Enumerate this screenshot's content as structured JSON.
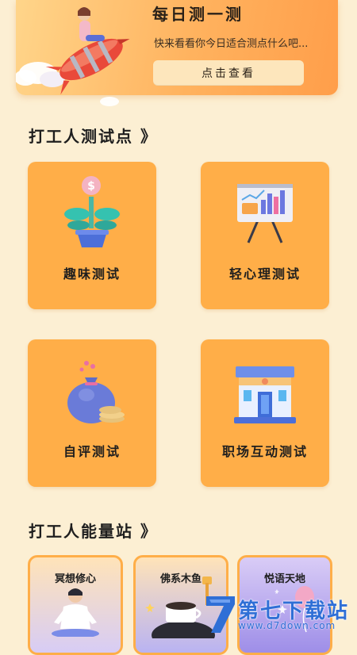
{
  "banner": {
    "title": "每日测一测",
    "subtitle": "快来看看你今日适合测点什么吧...",
    "button_label": "点击查看"
  },
  "sections": {
    "tests_title": "打工人测试点 》",
    "energy_title": "打工人能量站 》"
  },
  "cards": [
    {
      "label": "趣味测试",
      "icon": "money-plant-icon"
    },
    {
      "label": "轻心理测试",
      "icon": "chart-board-icon"
    },
    {
      "label": "自评测试",
      "icon": "money-bag-icon"
    },
    {
      "label": "职场互动测试",
      "icon": "office-building-icon"
    }
  ],
  "energy": [
    {
      "label": "冥想修心",
      "icon": "meditation-icon"
    },
    {
      "label": "佛系木鱼",
      "icon": "wooden-fish-icon"
    },
    {
      "label": "悦语天地",
      "icon": "balloon-icon"
    }
  ],
  "watermark": {
    "title": "第七下载站",
    "url": "www.d7down.com"
  },
  "colors": {
    "background": "#FCEFD3",
    "card": "#FFAE48",
    "banner_start": "#FFD58A",
    "banner_end": "#FF9E4A",
    "watermark": "#2F6FD6"
  }
}
